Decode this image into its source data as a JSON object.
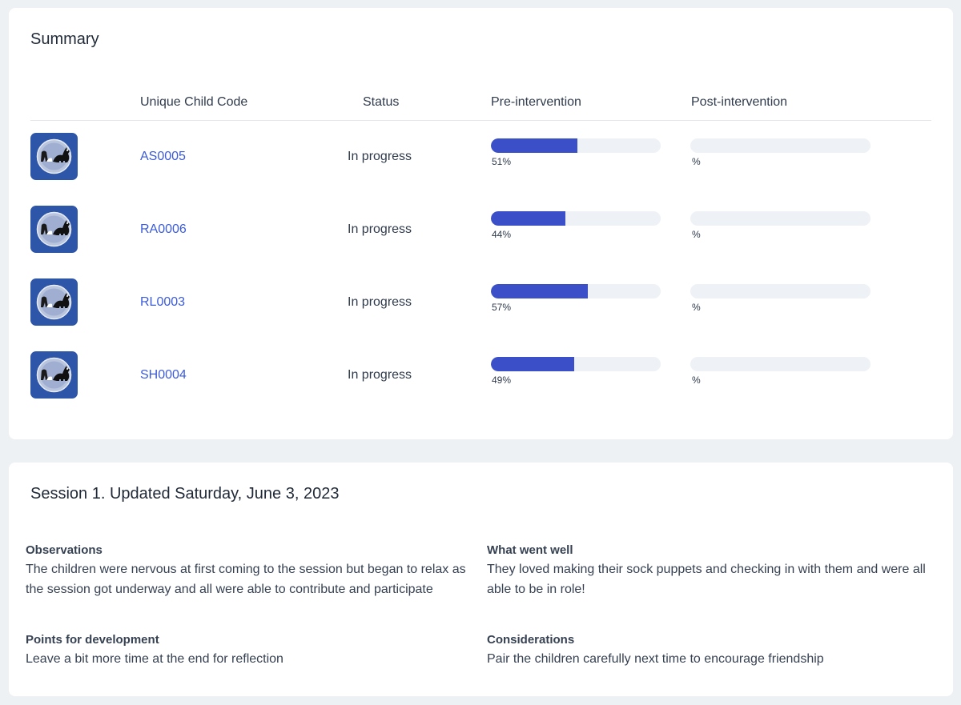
{
  "summary": {
    "title": "Summary",
    "headers": {
      "code": "Unique Child Code",
      "status": "Status",
      "pre": "Pre-intervention",
      "post": "Post-intervention"
    },
    "rows": [
      {
        "code": "AS0005",
        "status": "In progress",
        "pre_label": "51%",
        "pre_value": 51,
        "post_label": "%",
        "post_value": 0
      },
      {
        "code": "RA0006",
        "status": "In progress",
        "pre_label": "44%",
        "pre_value": 44,
        "post_label": "%",
        "post_value": 0
      },
      {
        "code": "RL0003",
        "status": "In progress",
        "pre_label": "57%",
        "pre_value": 57,
        "post_label": "%",
        "post_value": 0
      },
      {
        "code": "SH0004",
        "status": "In progress",
        "pre_label": "49%",
        "pre_value": 49,
        "post_label": "%",
        "post_value": 0
      }
    ]
  },
  "session": {
    "title": "Session 1. Updated Saturday, June 3, 2023",
    "observations": {
      "title": "Observations",
      "text": "The children were nervous at first coming to the session but began to relax as the session got underway and all were able to contribute and participate"
    },
    "went_well": {
      "title": "What went well",
      "text": "They loved making their sock puppets and checking in with them and were all able to be in role!"
    },
    "development": {
      "title": "Points for development",
      "text": "Leave a bit more time at the end for reflection"
    },
    "considerations": {
      "title": "Considerations",
      "text": "Pair the children carefully next time to encourage friendship"
    }
  },
  "colors": {
    "accent": "#3b50c8",
    "link": "#3b5bdb",
    "avatar_bg": "#2d55a8",
    "track": "#eef1f5"
  },
  "icons": {
    "avatar": "cat-moon-avatar-icon"
  }
}
